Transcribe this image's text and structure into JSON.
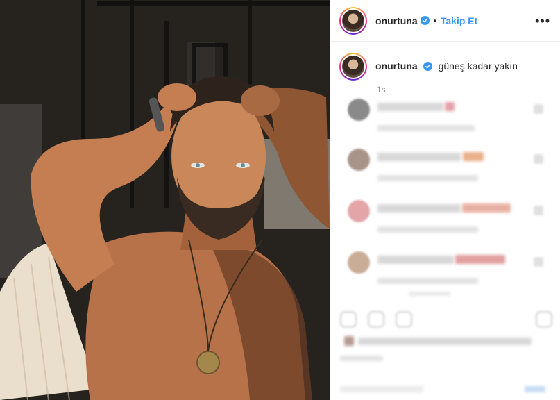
{
  "post": {
    "username": "onurtuna",
    "follow_label": "Takip Et",
    "dot": "•",
    "more": "•••",
    "caption": "güneş kadar yakın",
    "time": "1s"
  },
  "colors": {
    "link_blue": "#3897f0",
    "border": "#efefef",
    "muted_text": "#8e8e8e"
  },
  "icons": [
    "verified-badge-icon",
    "more-options-icon",
    "like-icon",
    "comment-icon",
    "share-icon",
    "save-icon"
  ]
}
